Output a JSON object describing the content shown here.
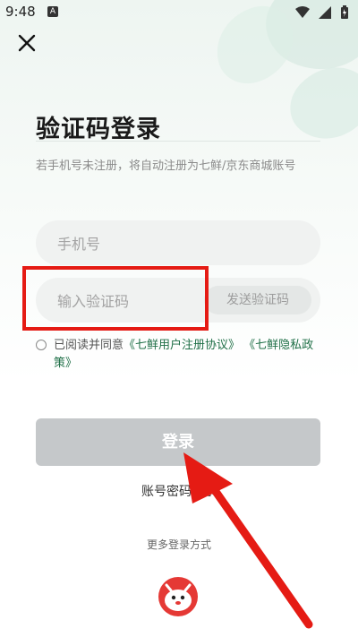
{
  "status_bar": {
    "time": "9:48",
    "badge": "A"
  },
  "header": {
    "close_icon": "close-icon"
  },
  "title": "验证码登录",
  "subtitle": "若手机号未注册，将自动注册为七鲜/京东商城账号",
  "phone_input": {
    "placeholder": "手机号",
    "value": ""
  },
  "code_input": {
    "placeholder": "输入验证码",
    "value": ""
  },
  "send_code_label": "发送验证码",
  "agreement": {
    "prefix": "已阅读并同意",
    "link1": "《七鲜用户注册协议》",
    "link2": "《七鲜隐私政策》"
  },
  "login_label": "登录",
  "password_login_label": "账号密码登录",
  "more_methods_label": "更多登录方式",
  "colors": {
    "accent_link": "#1f6f47",
    "highlight": "#e51b14",
    "arrow": "#e51b14",
    "button_disabled": "#c5c8ca"
  }
}
